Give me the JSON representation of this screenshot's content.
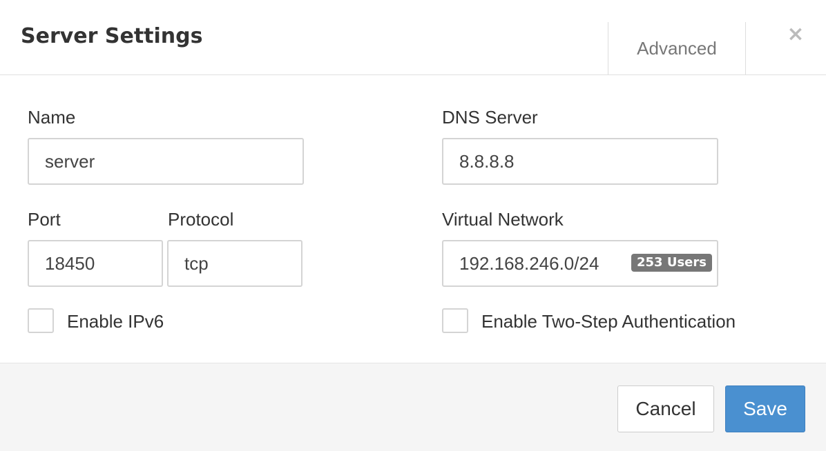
{
  "dialog": {
    "title": "Server Settings",
    "tab_label": "Advanced",
    "close_icon": "close-icon",
    "close_glyph": "×"
  },
  "form": {
    "name": {
      "label": "Name",
      "value": "server"
    },
    "dns": {
      "label": "DNS Server",
      "value": "8.8.8.8"
    },
    "port": {
      "label": "Port",
      "value": "18450"
    },
    "protocol": {
      "label": "Protocol",
      "value": "tcp"
    },
    "network": {
      "label": "Virtual Network",
      "value": "192.168.246.0/24",
      "badge": "253 Users"
    },
    "ipv6": {
      "label": "Enable IPv6",
      "checked": false
    },
    "two_step": {
      "label": "Enable Two-Step Authentication",
      "checked": false
    }
  },
  "footer": {
    "cancel_label": "Cancel",
    "save_label": "Save"
  },
  "colors": {
    "primary": "#4a90d0",
    "badge": "#777777",
    "footer_bg": "#f5f5f5",
    "border": "#d4d4d4"
  }
}
